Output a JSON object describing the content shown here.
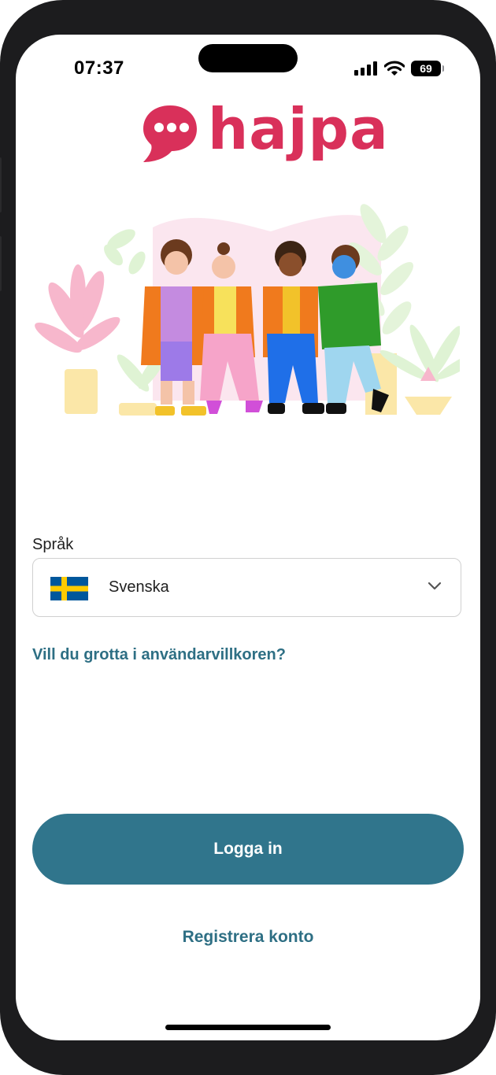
{
  "status_bar": {
    "time": "07:37",
    "battery": "69",
    "icons": [
      "cellular-signal-icon",
      "wifi-icon",
      "battery-icon"
    ]
  },
  "app": {
    "logo_text": "hajpa",
    "brand_color": "#d9305a",
    "accent_color": "#30758c"
  },
  "language": {
    "label": "Språk",
    "selected": "Svenska",
    "flag": "sweden-flag-icon"
  },
  "links": {
    "terms": "Vill du grotta i användarvillkoren?",
    "register": "Registrera konto"
  },
  "buttons": {
    "login": "Logga in"
  }
}
